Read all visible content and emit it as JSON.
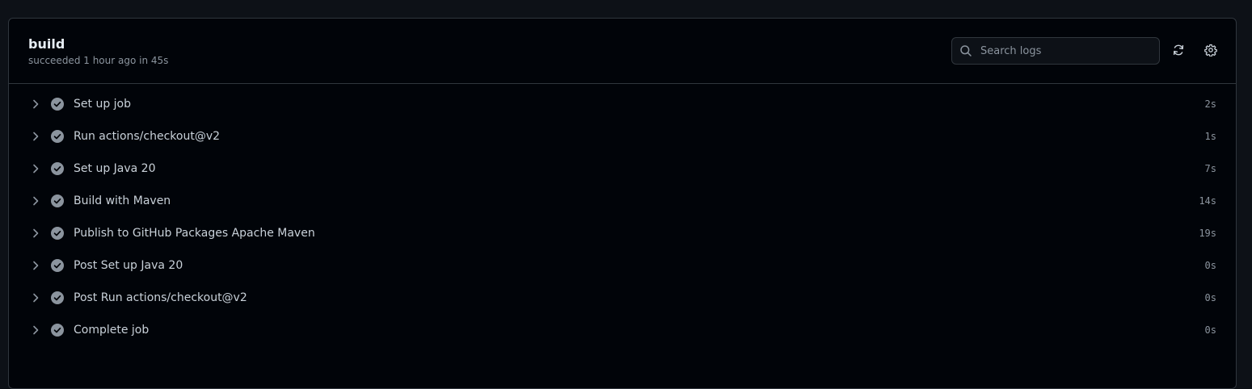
{
  "job": {
    "title": "build",
    "status": "succeeded 1 hour ago in 45s"
  },
  "search": {
    "placeholder": "Search logs"
  },
  "icons": {
    "search": "search-icon",
    "refresh": "refresh-icon",
    "settings": "gear-icon",
    "chevron": "chevron-right-icon",
    "success": "check-circle-icon"
  },
  "colors": {
    "background": "#0d1117",
    "panel": "#010409",
    "border": "#30363d",
    "text": "#e6edf3",
    "muted": "#8b949e",
    "success_icon": "#8b949e"
  },
  "steps": [
    {
      "name": "Set up job",
      "duration": "2s"
    },
    {
      "name": "Run actions/checkout@v2",
      "duration": "1s"
    },
    {
      "name": "Set up Java 20",
      "duration": "7s"
    },
    {
      "name": "Build with Maven",
      "duration": "14s"
    },
    {
      "name": "Publish to GitHub Packages Apache Maven",
      "duration": "19s"
    },
    {
      "name": "Post Set up Java 20",
      "duration": "0s"
    },
    {
      "name": "Post Run actions/checkout@v2",
      "duration": "0s"
    },
    {
      "name": "Complete job",
      "duration": "0s"
    }
  ]
}
